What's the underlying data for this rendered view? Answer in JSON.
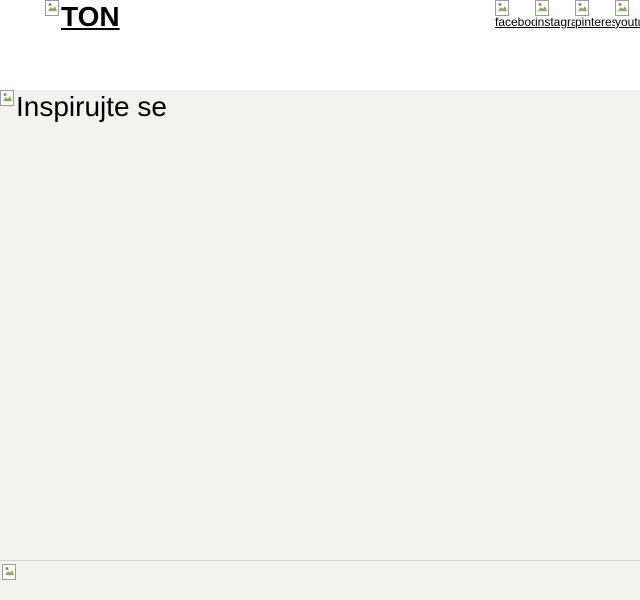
{
  "header": {
    "logo_alt": "TON",
    "social_links": [
      {
        "label": "facebook",
        "icon": "facebook-icon"
      },
      {
        "label": "instagram",
        "icon": "instagram-icon"
      },
      {
        "label": "pinterest",
        "icon": "pinterest-icon"
      },
      {
        "label": "youtube",
        "icon": "youtube-icon"
      }
    ]
  },
  "hero": {
    "title": "Inspirujte se"
  },
  "colors": {
    "hero_background": "#f3f3ee",
    "footer_border": "#d4d4d0"
  }
}
